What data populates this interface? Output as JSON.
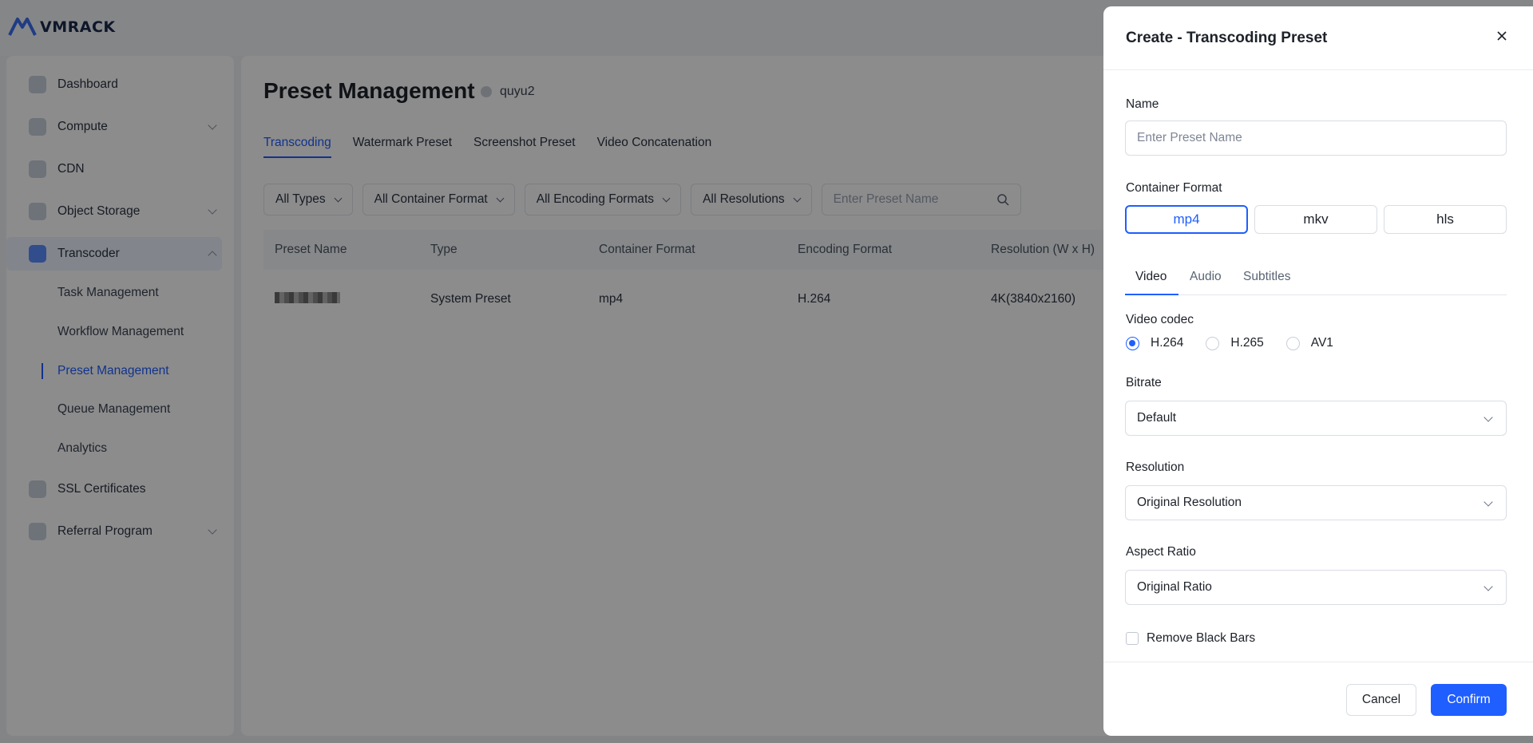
{
  "brand": {
    "name": "VMRACK"
  },
  "sidebar": {
    "items": [
      {
        "label": "Dashboard",
        "icon": "dashboard-icon"
      },
      {
        "label": "Compute",
        "icon": "compute-icon"
      },
      {
        "label": "CDN",
        "icon": "cdn-icon"
      },
      {
        "label": "Object Storage",
        "icon": "storage-icon"
      },
      {
        "label": "Transcoder",
        "icon": "transcoder-icon"
      },
      {
        "label": "SSL Certificates",
        "icon": "ssl-icon"
      },
      {
        "label": "Referral Program",
        "icon": "referral-icon"
      }
    ],
    "subitems": [
      {
        "label": "Task Management"
      },
      {
        "label": "Workflow Management"
      },
      {
        "label": "Preset Management"
      },
      {
        "label": "Queue Management"
      },
      {
        "label": "Analytics"
      }
    ]
  },
  "main": {
    "title": "Preset Management",
    "region": "quyu2",
    "tabs": [
      "Transcoding",
      "Watermark Preset",
      "Screenshot Preset",
      "Video Concatenation"
    ],
    "filters": [
      "All Types",
      "All Container Format",
      "All Encoding Formats",
      "All Resolutions"
    ],
    "search_placeholder": "Enter Preset Name",
    "table": {
      "headers": [
        "Preset Name",
        "Type",
        "Container Format",
        "Encoding Format",
        "Resolution (W x H)"
      ],
      "rows": [
        {
          "type": "System Preset",
          "container": "mp4",
          "encoding": "H.264",
          "resolution": "4K(3840x2160)"
        }
      ]
    }
  },
  "drawer": {
    "title": "Create - Transcoding Preset",
    "name_label": "Name",
    "name_placeholder": "Enter Preset Name",
    "name_value": "",
    "container_label": "Container Format",
    "container_options": [
      "mp4",
      "mkv",
      "hls"
    ],
    "container_selected": "mp4",
    "subtabs": [
      "Video",
      "Audio",
      "Subtitles"
    ],
    "subtab_active": "Video",
    "codec_label": "Video codec",
    "codec_options": [
      "H.264",
      "H.265",
      "AV1"
    ],
    "codec_selected": "H.264",
    "bitrate_label": "Bitrate",
    "bitrate_value": "Default",
    "resolution_label": "Resolution",
    "resolution_value": "Original Resolution",
    "aspect_label": "Aspect Ratio",
    "aspect_value": "Original Ratio",
    "remove_black_bars_label": "Remove Black Bars",
    "remove_black_bars_checked": false,
    "cancel_label": "Cancel",
    "confirm_label": "Confirm"
  },
  "colors": {
    "accent": "#1f5eff",
    "overlay": "rgba(0,0,0,0.45)"
  }
}
